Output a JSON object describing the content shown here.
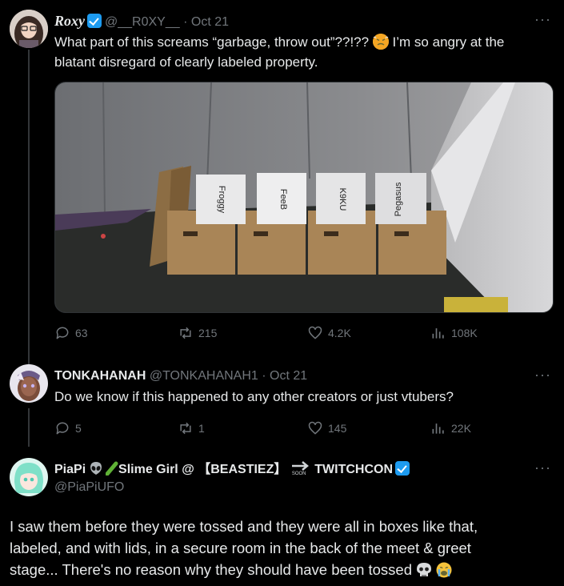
{
  "tweet1": {
    "display_name": "Roxy",
    "handle": "@__R0XY__",
    "time": "· Oct 21",
    "more": "···",
    "text_line1": "What part of this screams “garbage, throw out”??!??",
    "text_line1_after": "I’m so angry at the",
    "text_line2": "blatant disregard of clearly labeled property.",
    "box_labels": [
      "Froggy",
      "FeeB",
      "K9KU",
      "Pegasus"
    ],
    "stats": {
      "replies": "63",
      "retweets": "215",
      "likes": "4.2K",
      "views": "108K"
    }
  },
  "tweet2": {
    "display_name": "TONKAHANAH",
    "handle": "@TONKAHANAH1",
    "time": "· Oct 21",
    "more": "···",
    "text": "Do we know if this happened to any other creators or just vtubers?",
    "stats": {
      "replies": "5",
      "retweets": "1",
      "likes": "145",
      "views": "22K"
    }
  },
  "tweet3": {
    "display_name_prefix": "PiaPi",
    "display_name_mid": "Slime Girl @ 【BEASTIEZ】",
    "soon": "SOON",
    "display_name_suffix": "TWITCHCON",
    "handle": "@PiaPiUFO",
    "more": "···",
    "text_line1": "I saw them before they were tossed and they were all in boxes like that,",
    "text_line2": "labeled, and with lids, in a secure room in the back of the meet & greet",
    "text_line3": "stage... There's no reason why they should have been tossed"
  },
  "colors": {
    "bg": "#000000",
    "text": "#e7e9ea",
    "muted": "#71767b",
    "verified": "#1d9bf0"
  },
  "icons": [
    "reply-icon",
    "retweet-icon",
    "like-icon",
    "views-icon",
    "verified-badge-icon",
    "more-icon"
  ]
}
